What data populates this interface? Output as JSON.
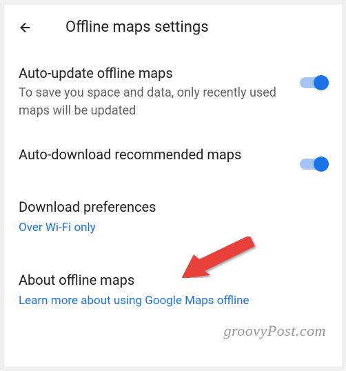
{
  "header": {
    "title": "Offline maps settings"
  },
  "sections": {
    "auto_update": {
      "title": "Auto-update offline maps",
      "desc": "To save you space and data, only recently used maps will be updated",
      "toggle_on": true
    },
    "auto_download": {
      "title": "Auto-download recommended maps",
      "toggle_on": true
    },
    "download_prefs": {
      "title": "Download preferences",
      "link": "Over Wi-Fi only"
    },
    "about": {
      "title": "About offline maps",
      "link": "Learn more about using Google Maps offline"
    }
  },
  "watermark": "groovyPost.com",
  "colors": {
    "accent": "#1a73e8",
    "text_primary": "#202124",
    "text_secondary": "#5f6368"
  }
}
